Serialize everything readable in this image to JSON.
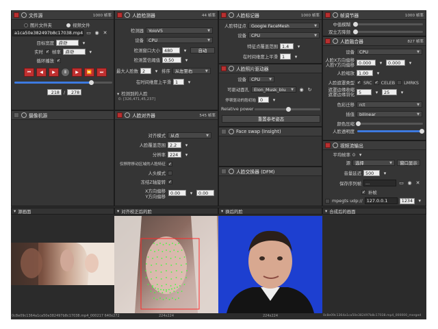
{
  "file_source": {
    "title": "文件源",
    "fps": "1000 帧率",
    "tab_image_folder": "图片文件夹",
    "tab_video_file": "视频文件",
    "file_path": "a1ca50e382497b8c17038.mp4",
    "target_width_label": "目标宽度",
    "target_width_value": "自动",
    "realtime_label": "实时",
    "fps_label": "帧率",
    "fps_value": "自动",
    "loop_label": "循环播放",
    "frame_current": "218",
    "frame_total": "278",
    "progress": 0.78
  },
  "camera_source": {
    "title": "摄像机源"
  },
  "face_detector": {
    "title": "人脸检测器",
    "fps": "44 帧率",
    "detector_label": "检测器",
    "detector_value": "YoloV5",
    "device_label": "设备",
    "device_value": "CPU",
    "window_size_label": "检测窗口大小",
    "window_size_value": "480",
    "auto_button": "自动",
    "threshold_label": "检测置信阈值",
    "threshold_value": "0.50",
    "max_faces_label": "最大人脸数",
    "max_faces_value": "2",
    "sort_label": "排序",
    "sort_value": "从左至右",
    "temporal_label": "在时间维度上平滑",
    "temporal_value": "1",
    "detected_label": "检测到的人脸",
    "detected_value": "0: [326,471,45,237]"
  },
  "face_marker": {
    "title": "人脸标记器",
    "fps": "1000 帧率",
    "landmarks_label": "人脸特征点",
    "landmarks_value": "Google FaceMesh",
    "device_label": "设备",
    "device_value": "CPU",
    "coverage_label": "特征点覆盖范围",
    "coverage_value": "1.4",
    "temporal_label": "在时间维度上平滑",
    "temporal_value": "1"
  },
  "face_animator": {
    "title": "人脸照片驱动器",
    "device_label": "设备",
    "device_value": "CPU",
    "model_label": "可驱动面孔",
    "model_value": "Elon_Musk_blu",
    "variant_label": "停顿驱动的脸初始",
    "variant_value": "0",
    "relative_power_label": "Relative power",
    "reset_button": "重置参考姿态"
  },
  "face_swap_insight": {
    "title": "Face swap (Insight)"
  },
  "face_swap_dfm": {
    "title": "人脸交换器 (DFM)"
  },
  "frame_adjuster": {
    "title": "帧调节器",
    "fps": "1000 帧率",
    "median_label": "中值模糊",
    "sharpen_label": "双立方降频"
  },
  "face_merger": {
    "title": "人脸融合器",
    "fps": "827 帧率",
    "device_label": "设备",
    "device_value": "CPU",
    "offset_x_label": "人脸X方向偏移",
    "offset_x_value": "0.000",
    "offset_y_label": "人脸Y方向偏移",
    "offset_y_value": "0.000",
    "scale_label": "人脸缩放",
    "scale_value": "1.00",
    "mask_type_label": "人脸遮罩类型",
    "mask_src": "SRC",
    "mask_celeb": "CELEB",
    "mask_lmrks": "LMRKS",
    "erode_label": "遮罩边缘收缩",
    "erode_value": "5",
    "blur_label": "遮罩边缘羽化",
    "blur_value": "25",
    "color_transfer_label": "色彩迁移",
    "color_transfer_value": "rct",
    "interpolation_label": "插值",
    "interpolation_value": "bilinear",
    "color_compress_label": "颜色压缩",
    "opacity_label": "人脸透明度"
  },
  "face_aligner": {
    "title": "人脸对齐器",
    "fps": "545 帧率",
    "align_mode_label": "对齐模式",
    "align_mode_value": "从点",
    "coverage_label": "人脸覆盖范围",
    "coverage_value": "2.2",
    "resolution_label": "分辨率",
    "resolution_value": "224",
    "exclude_moving_label": "仅移除移动区域的人脸特征",
    "head_mode_label": "人头模式",
    "freeze_z_label": "冻结Z轴旋转",
    "x_offset_label": "X方向偏移",
    "y_offset_label": "Y方向偏移",
    "x_offset_value": "0.00",
    "y_offset_value": "0.00"
  },
  "stream_output": {
    "title": "视频流输出",
    "avg_fps_label": "平均帧率",
    "avg_fps_value": "0",
    "source_label": "源",
    "source_value": "选择",
    "window_button": "窗口显示",
    "delay_label": "音量延迟",
    "delay_value": "500",
    "save_path_label": "保存序列帧",
    "save_path_value": "...",
    "fill_label": "补帧",
    "mpegts_label": "mpegts udp://",
    "ip_value": "127.0.0.1",
    "port_value": "1234"
  },
  "bottom": {
    "source_frame_label": "源画面",
    "aligned_face_label": "对齐校正后的脸",
    "swapped_face_label": "换后的脸",
    "merged_frame_label": "合成后的画面",
    "source_caption": "0c8e09c1364a1ca50e382497b8c17038.mp4_000217 640x272",
    "aligned_caption": "224x224",
    "swapped_caption": "224x224",
    "merged_caption": "0c8e09c1364a1ca50e382497b8c17038.mp4_000000_merged"
  },
  "colors": {
    "power_on": "#b83030",
    "accent": "#3d7ae0",
    "swap_bg": "#1d3fd0"
  }
}
